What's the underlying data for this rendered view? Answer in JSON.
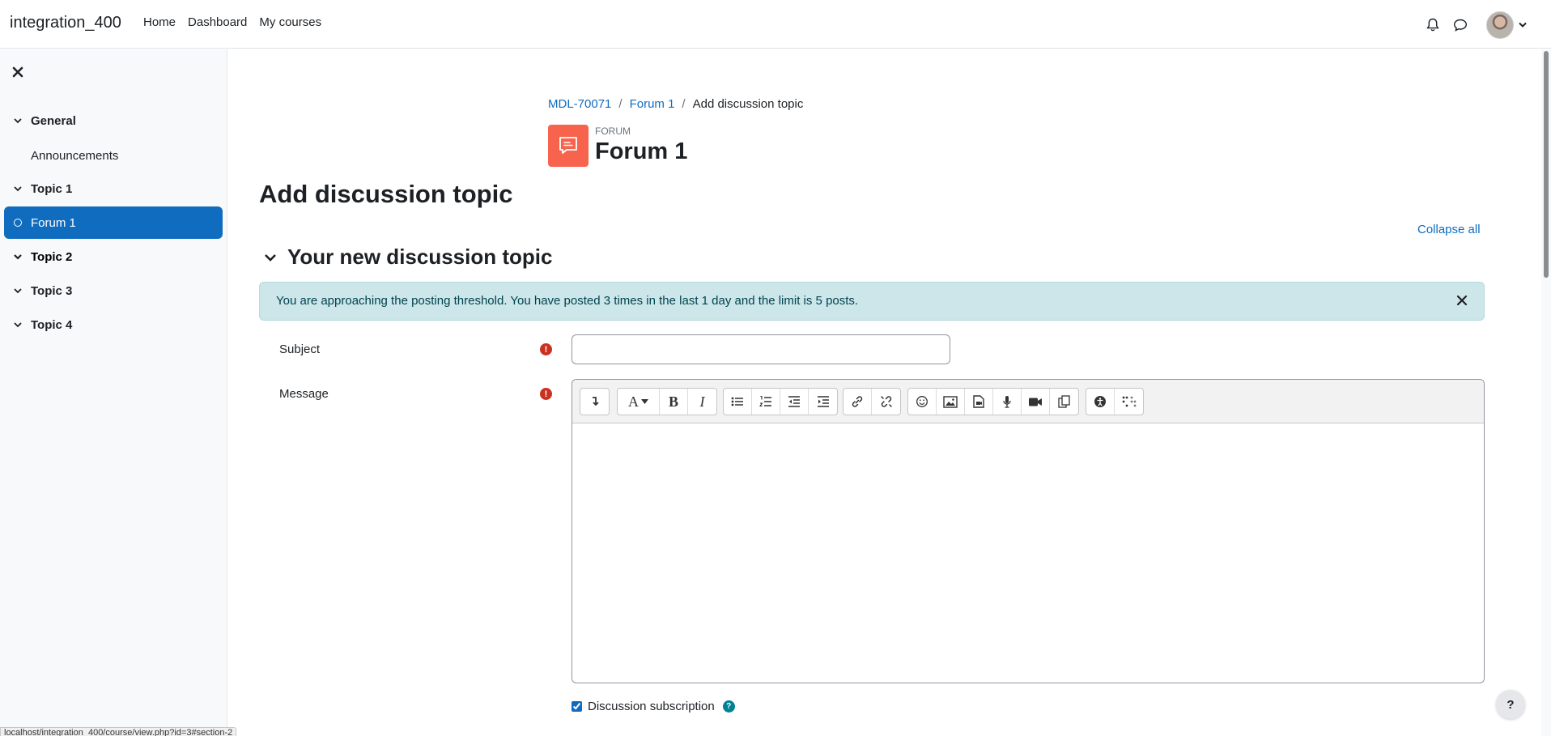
{
  "navbar": {
    "brand": "integration_400",
    "links": [
      "Home",
      "Dashboard",
      "My courses"
    ]
  },
  "drawer": {
    "items": [
      {
        "type": "section",
        "label": "General"
      },
      {
        "type": "activity",
        "label": "Announcements"
      },
      {
        "type": "section",
        "label": "Topic 1"
      },
      {
        "type": "activity",
        "label": "Forum 1",
        "active": true
      },
      {
        "type": "section",
        "label": "Topic 2"
      },
      {
        "type": "section",
        "label": "Topic 3"
      },
      {
        "type": "section",
        "label": "Topic 4"
      }
    ]
  },
  "breadcrumb": {
    "course": "MDL-70071",
    "forum": "Forum 1",
    "current": "Add discussion topic"
  },
  "activity_header": {
    "kind": "FORUM",
    "title": "Forum 1"
  },
  "page": {
    "heading": "Add discussion topic",
    "collapse_all": "Collapse all",
    "fieldset": "Your new discussion topic"
  },
  "alert": {
    "message": "You are approaching the posting threshold. You have posted 3 times in the last 1 day and the limit is 5 posts."
  },
  "form": {
    "subject_label": "Subject",
    "subject_value": "",
    "message_label": "Message",
    "subscription_label": "Discussion subscription",
    "subscription_checked": true
  },
  "editor_toolbar": [
    [
      "show-more-icon"
    ],
    [
      "font-style-icon",
      "bold-icon",
      "italic-icon"
    ],
    [
      "unordered-list-icon",
      "ordered-list-icon",
      "outdent-icon",
      "indent-icon"
    ],
    [
      "link-icon",
      "unlink-icon"
    ],
    [
      "emoji-icon",
      "image-icon",
      "media-icon",
      "record-audio-icon",
      "record-video-icon",
      "manage-files-icon"
    ],
    [
      "accessibility-checker-icon",
      "screenreader-helper-icon"
    ]
  ],
  "status_bar": "localhost/integration_400/course/view.php?id=3#section-2",
  "colors": {
    "primary": "#0f6cbf",
    "forum_icon": "#f7634d",
    "alert_bg": "#cce6ea",
    "required": "#ca3120",
    "help": "#008196"
  }
}
